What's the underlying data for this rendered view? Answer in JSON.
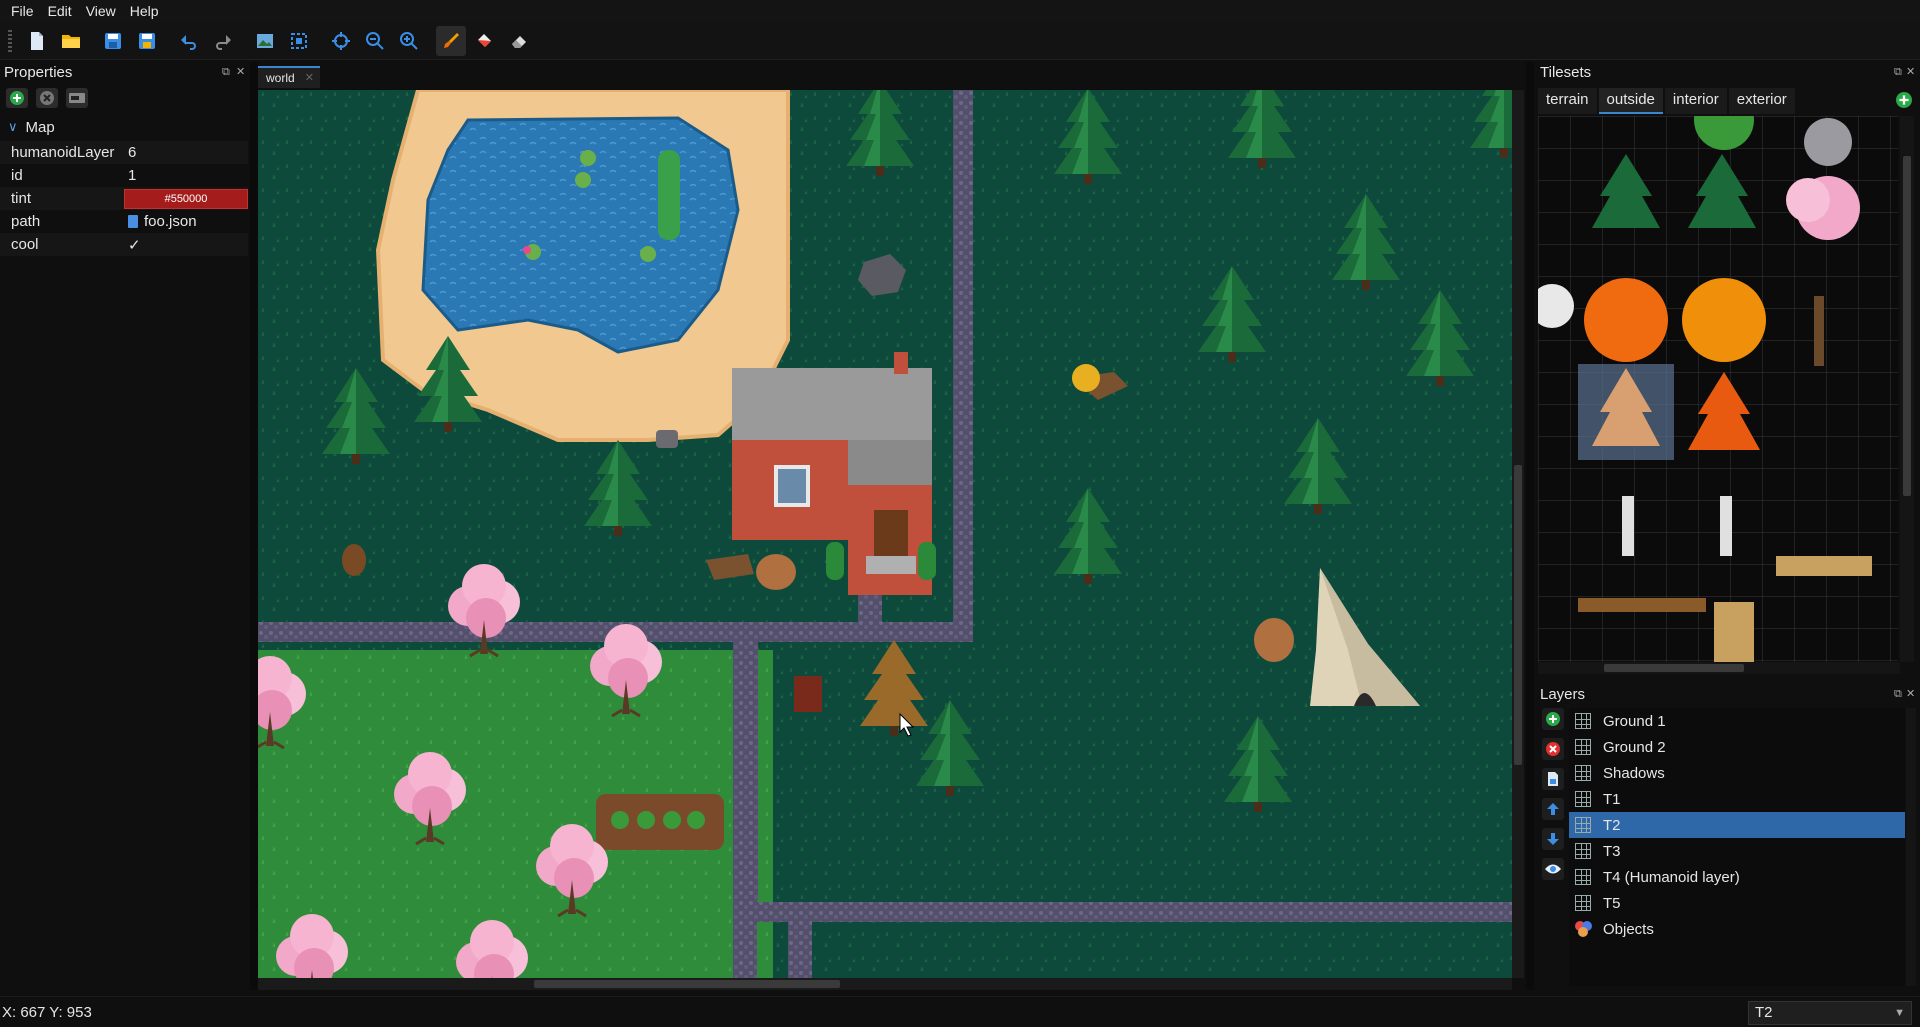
{
  "menu": {
    "items": [
      "File",
      "Edit",
      "View",
      "Help"
    ]
  },
  "toolbar": {
    "icons": [
      "new-file-icon",
      "open-folder-icon",
      "save-icon",
      "save-all-icon",
      "undo-icon",
      "redo-icon",
      "image-icon",
      "select-icon",
      "crosshair-icon",
      "zoom-out-icon",
      "zoom-in-icon",
      "brush-icon",
      "fill-icon",
      "eraser-icon"
    ],
    "active": "brush-icon"
  },
  "properties": {
    "title": "Properties",
    "section": "Map",
    "rows": [
      {
        "key": "humanoidLayer",
        "value": "6"
      },
      {
        "key": "id",
        "value": "1"
      },
      {
        "key": "tint",
        "value": "#550000"
      },
      {
        "key": "path",
        "value": "foo.json"
      },
      {
        "key": "cool",
        "value": "✓"
      }
    ]
  },
  "document": {
    "tab": "world"
  },
  "tilesets": {
    "title": "Tilesets",
    "tabs": [
      "terrain",
      "outside",
      "interior",
      "exterior"
    ],
    "selected_tab": "outside"
  },
  "layers": {
    "title": "Layers",
    "items": [
      "Ground 1",
      "Ground 2",
      "Shadows",
      "T1",
      "T2",
      "T3",
      "T4 (Humanoid layer)",
      "T5",
      "Objects"
    ],
    "selected": "T2"
  },
  "status": {
    "coords": "X: 667 Y: 953",
    "current_layer": "T2"
  },
  "colors": {
    "accent": "#2f68a8",
    "grass_dark": "#0e4a3c",
    "grass_light": "#2a8a3a",
    "sand": "#f0c890",
    "water": "#2a7ab8",
    "path": "#5e5a78",
    "tint": "#a41c1c"
  }
}
